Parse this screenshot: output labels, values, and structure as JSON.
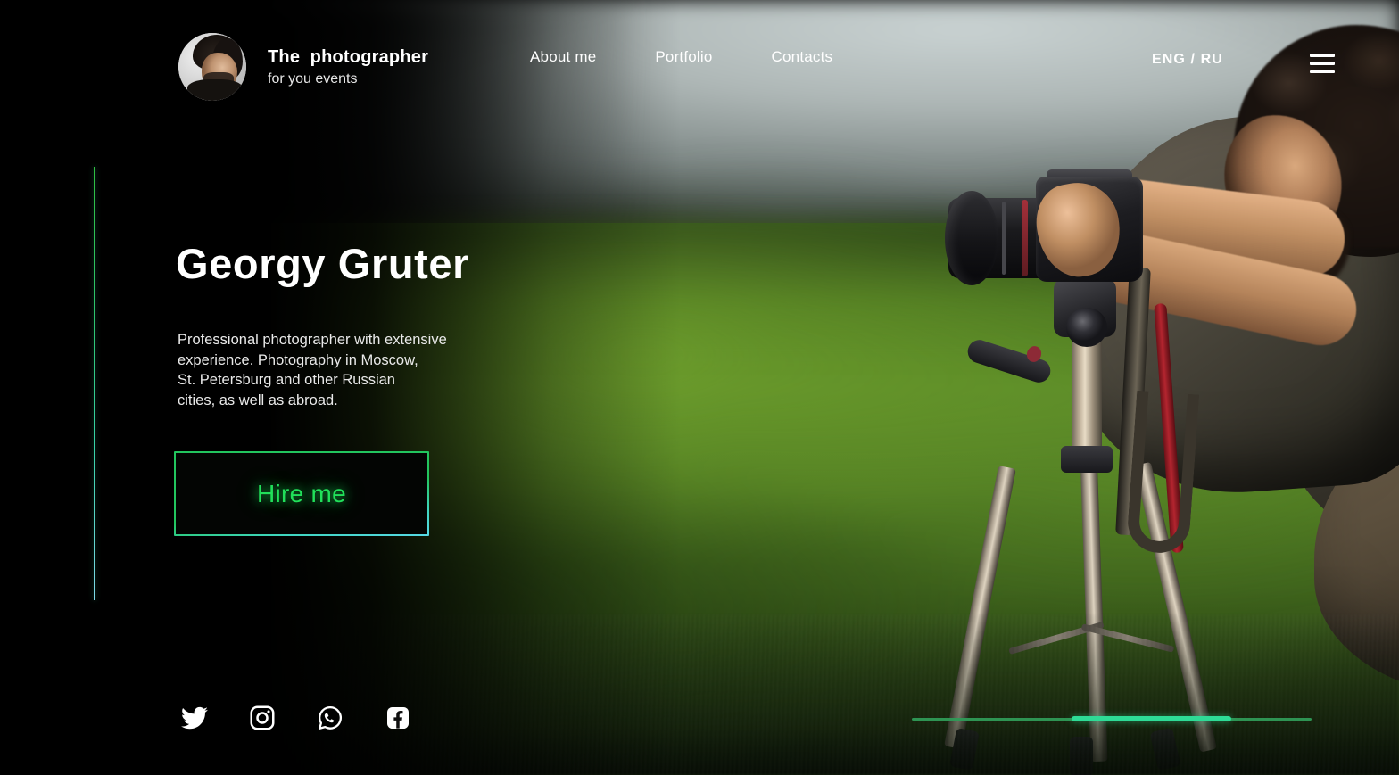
{
  "header": {
    "brand": {
      "title": "The  photographer",
      "subtitle": "for you events",
      "avatar_alt": "avatar"
    },
    "nav": [
      {
        "label": "About me"
      },
      {
        "label": "Portfolio"
      },
      {
        "label": "Contacts"
      }
    ],
    "language_switch": "ENG / RU",
    "menu_icon": "hamburger-menu-icon"
  },
  "hero": {
    "name": "Georgy Gruter",
    "description": "Professional photographer with extensive\nexperience. Photography in Moscow,\nSt. Petersburg and  other Russian\ncities, as well as abroad.",
    "cta_label": "Hire me"
  },
  "social": [
    {
      "name": "twitter",
      "icon": "twitter-icon"
    },
    {
      "name": "instagram",
      "icon": "instagram-icon"
    },
    {
      "name": "whatsapp",
      "icon": "whatsapp-icon"
    },
    {
      "name": "facebook",
      "icon": "facebook-icon"
    }
  ],
  "slider": {
    "track_color": "#2f9a57",
    "fill_color": "#2edb96",
    "fill_start_pct": 40,
    "fill_width_pct": 40
  },
  "colors": {
    "background": "#000000",
    "accent_green": "#22c55e",
    "accent_cyan": "#57d9e6",
    "cta_text": "#21e05a",
    "text_primary": "#ffffff",
    "text_secondary": "#e9e9e9"
  }
}
